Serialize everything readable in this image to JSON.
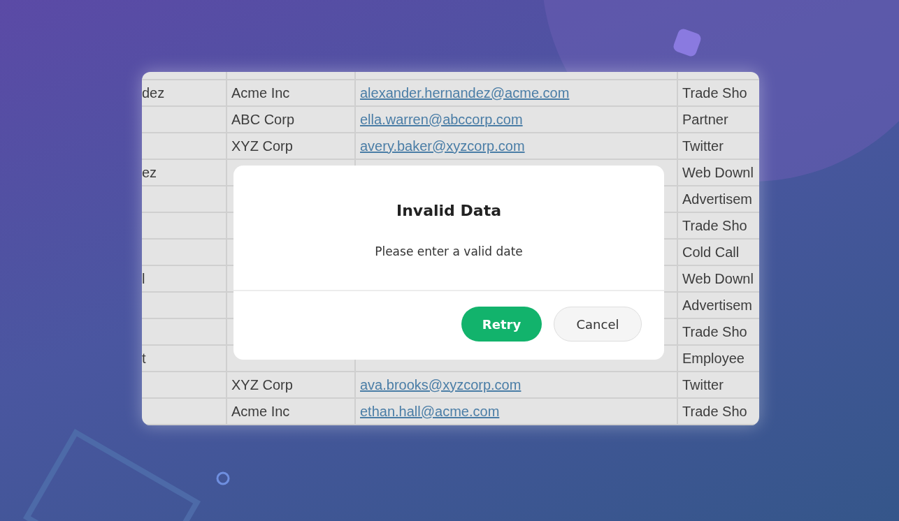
{
  "table": {
    "rows": [
      {},
      {
        "column_1": "dez",
        "column_2": "Acme Inc",
        "column_3": "alexander.hernandez@acme.com",
        "column_4": "Trade Sho"
      },
      {
        "column_2": "ABC Corp",
        "column_3": "ella.warren@abccorp.com",
        "column_4": "Partner"
      },
      {
        "column_2": "XYZ Corp",
        "column_3": "avery.baker@xyzcorp.com",
        "column_4": "Twitter"
      },
      {
        "column_1": "ez",
        "column_4": "Web Downl"
      },
      {
        "column_4": "Advertisem"
      },
      {
        "column_4": "Trade Sho"
      },
      {
        "column_4": "Cold Call"
      },
      {
        "column_1": "l",
        "column_4": "Web Downl"
      },
      {
        "column_4": "Advertisem"
      },
      {
        "column_4": "Trade Sho"
      },
      {
        "column_1": "t",
        "column_4": "Employee"
      },
      {
        "column_2": "XYZ Corp",
        "column_3": "ava.brooks@xyzcorp.com",
        "column_4": "Twitter"
      },
      {
        "column_2": "Acme Inc",
        "column_3": "ethan.hall@acme.com",
        "column_4": "Trade Sho"
      }
    ]
  },
  "dialog": {
    "title": "Invalid Data",
    "message": "Please enter a valid date",
    "buttons": [
      {
        "label": "Retry",
        "kind": "primary"
      },
      {
        "label": "Cancel",
        "kind": "secondary"
      }
    ]
  }
}
